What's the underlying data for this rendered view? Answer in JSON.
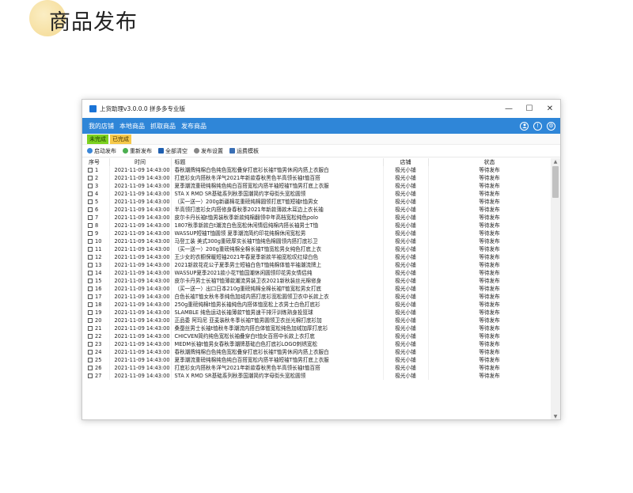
{
  "page": {
    "title": "商品发布"
  },
  "window": {
    "title": "上货助理v3.0.0.0 拼多多专业版",
    "controls": {
      "minimize": "—",
      "maximize": "☐",
      "close": "✕"
    }
  },
  "menu": {
    "items": [
      "我的店铺",
      "本地商品",
      "抓取商品",
      "发布商品"
    ],
    "icons": [
      "user-icon",
      "info-icon",
      "gear-icon"
    ]
  },
  "status_tags": {
    "pending": "未完成",
    "done": "已完成"
  },
  "toolbar": {
    "items": [
      {
        "label": "启动发布",
        "icon": "play-icon",
        "color": "#3a86d8"
      },
      {
        "label": "重新发布",
        "icon": "refresh-icon",
        "color": "#4caf50"
      },
      {
        "label": "全部清空",
        "icon": "clear-icon",
        "color": "#1f5fb0"
      },
      {
        "label": "发布设置",
        "icon": "gear-icon",
        "color": "#888888"
      },
      {
        "label": "运费模板",
        "icon": "truck-icon",
        "color": "#3a6fb5"
      }
    ]
  },
  "table": {
    "columns": [
      "序号",
      "时间",
      "标题",
      "店铺",
      "状态"
    ],
    "rows": [
      {
        "no": "1",
        "time": "2021-11-09 14:43:00",
        "title": "春秋潮牌纯棉白色纯色宽松叠穿打底衫长袖T恤男休闲内搭上衣服白",
        "shop": "极光小铺",
        "status": "等待发布"
      },
      {
        "no": "2",
        "time": "2021-11-09 14:43:00",
        "title": "打底衫女内搭秋冬洋气2021年新款春秋黑色半高领长袖t恤百搭",
        "shop": "极光小铺",
        "status": "等待发布"
      },
      {
        "no": "3",
        "time": "2021-11-09 14:43:00",
        "title": "夏季潮流重磅纯棉纯色纯白百搭宽松内搭半袖短袖T恤男打底上衣服",
        "shop": "极光小铺",
        "status": "等待发布"
      },
      {
        "no": "4",
        "time": "2021-11-09 14:43:00",
        "title": "STA X RMD SR基础系列秋季国潮简约字母街头宽松圆领",
        "shop": "极光小铺",
        "status": "等待发布"
      },
      {
        "no": "5",
        "time": "2021-11-09 14:43:00",
        "title": "（买一送一）200g新疆棉花重磅纯棉圆领打底T恤短袖t恤男女",
        "shop": "极光小铺",
        "status": "等待发布"
      },
      {
        "no": "6",
        "time": "2021-11-09 14:43:00",
        "title": "半高领打底衫女内搭修身春秋季2021年新款薄款木耳边上衣长袖",
        "shop": "极光小铺",
        "status": "等待发布"
      },
      {
        "no": "7",
        "time": "2021-11-09 14:43:00",
        "title": "皮尔卡丹长袖t恤男装秋季新款纯棉翻领中年高档宽松纯色polo",
        "shop": "极光小铺",
        "status": "等待发布"
      },
      {
        "no": "8",
        "time": "2021-11-09 14:43:00",
        "title": "1807秋季新款白t潮流白色宽松休闲情侣纯棉内搭长袖男士T恤",
        "shop": "极光小铺",
        "status": "等待发布"
      },
      {
        "no": "9",
        "time": "2021-11-09 14:43:00",
        "title": "WASSUP短袖T恤圆领 夏季潮流简约印花纯棉休闲宽松男",
        "shop": "极光小铺",
        "status": "等待发布"
      },
      {
        "no": "10",
        "time": "2021-11-09 14:43:00",
        "title": "马登工装 美式300g重磅厚实长袖T恤纯色棉圆领内搭打底衫卫",
        "shop": "极光小铺",
        "status": "等待发布"
      },
      {
        "no": "11",
        "time": "2021-11-09 14:43:00",
        "title": "（买一送一）200g重磅纯棉全棉长袖T恤宽松男女纯色打底上衣",
        "shop": "极光小铺",
        "status": "等待发布"
      },
      {
        "no": "12",
        "time": "2021-11-09 14:43:00",
        "title": "王少女的衣橱保暖短袖2021年春夏季新款半袖宽松叹红绿白色",
        "shop": "极光小铺",
        "status": "等待发布"
      },
      {
        "no": "13",
        "time": "2021-11-09 14:43:00",
        "title": "2021新款花花公子夏季男士短袖白色T恤纯棉体恤半袖潮流牌上",
        "shop": "极光小铺",
        "status": "等待发布"
      },
      {
        "no": "14",
        "time": "2021-11-09 14:43:00",
        "title": "WASSUP夏季2021款小花T恤国潮休闲圆领印花男女情侣纯",
        "shop": "极光小铺",
        "status": "等待发布"
      },
      {
        "no": "15",
        "time": "2021-11-09 14:43:00",
        "title": "皮尔卡丹男士长袖T恤薄款潮流男装卫衣2021新秋装丝光棉修身",
        "shop": "极光小铺",
        "status": "等待发布"
      },
      {
        "no": "16",
        "time": "2021-11-09 14:43:00",
        "title": "（买一送一）出口日本210g重磅纯棉全棉长袖T恤宽松男女打底",
        "shop": "极光小铺",
        "status": "等待发布"
      },
      {
        "no": "17",
        "time": "2021-11-09 14:43:00",
        "title": "白色长袖T恤女秋冬季纯色加绒内搭打底衫宽松圆领卫衣中长款上衣",
        "shop": "极光小铺",
        "status": "等待发布"
      },
      {
        "no": "18",
        "time": "2021-11-09 14:43:00",
        "title": "250g重磅纯棉t恤男长袖纯色内搭体恤宽松上衣男士白色打底衫",
        "shop": "极光小铺",
        "status": "等待发布"
      },
      {
        "no": "19",
        "time": "2021-11-09 14:43:00",
        "title": "SLAMBLE 纯色运动长袖薄款T恤男速干排汗训练熟身投篮球",
        "shop": "极光小铺",
        "status": "等待发布"
      },
      {
        "no": "20",
        "time": "2021-11-09 14:43:00",
        "title": "正品委 阿玛尼 亚麦装秋冬季长袖T恤男圆领卫衣丝光棉打底衫加",
        "shop": "极光小铺",
        "status": "等待发布"
      },
      {
        "no": "21",
        "time": "2021-11-09 14:43:00",
        "title": "桑蚕丝男士长袖t恤秋冬季潮流内搭白体恤宽松纯色加绒加厚打底衫",
        "shop": "极光小铺",
        "status": "等待发布"
      },
      {
        "no": "22",
        "time": "2021-11-09 14:43:00",
        "title": "CHICVEN简约纯色宽松长袖叠穿白t恤女百搭中长款上衣打底",
        "shop": "极光小铺",
        "status": "等待发布"
      },
      {
        "no": "23",
        "time": "2021-11-09 14:43:00",
        "title": "MEDM长袖t恤男女春秋季潮牌基础白色打底衫LOGO刺绣宽松",
        "shop": "极光小铺",
        "status": "等待发布"
      },
      {
        "no": "24",
        "time": "2021-11-09 14:43:00",
        "title": "春秋潮牌纯棉白色纯色宽松叠穿打底衫长袖T恤男休闲内搭上衣服白",
        "shop": "极光小铺",
        "status": "等待发布"
      },
      {
        "no": "25",
        "time": "2021-11-09 14:43:00",
        "title": "夏季潮流重磅纯棉纯色纯白百搭宽松内搭半袖短袖T恤男打底上衣服",
        "shop": "极光小铺",
        "status": "等待发布"
      },
      {
        "no": "26",
        "time": "2021-11-09 14:43:00",
        "title": "打底衫女内搭秋冬洋气2021年新款春秋黑色半高领长袖t恤百搭",
        "shop": "极光小铺",
        "status": "等待发布"
      },
      {
        "no": "27",
        "time": "2021-11-09 14:43:00",
        "title": "STA X RMD SR基础系列秋季国潮简约字母街头宽松圆领",
        "shop": "极光小铺",
        "status": "等待发布"
      }
    ]
  },
  "scrollbar": {
    "up": "▲",
    "down": "▼"
  }
}
